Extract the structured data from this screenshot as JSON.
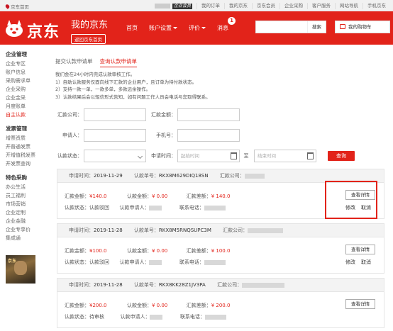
{
  "topbar": {
    "home": "京东首页",
    "user_tag": "企业会员",
    "links": [
      "我的订单",
      "我的京东",
      "京东会员",
      "企业采购",
      "客户服务",
      "网站导航",
      "手机京东"
    ]
  },
  "header": {
    "logo_text": "京东",
    "my_jd": "我的京东",
    "back_home": "返回京东首页",
    "nav": [
      {
        "label": "首页"
      },
      {
        "label": "账户设置",
        "dropdown": true
      },
      {
        "label": "评价",
        "dropdown": true
      },
      {
        "label": "消息",
        "badge": "1"
      }
    ],
    "search_button": "搜索",
    "cart": "我的购物车",
    "brand_color": "#e2231a"
  },
  "sidebar": {
    "sections": [
      {
        "title": "企业管理",
        "items": [
          "企业专区",
          "账户信息",
          "采购需求单",
          "企业采购",
          "企业金采",
          "月度账单",
          "自主认款"
        ]
      },
      {
        "title": "发票管理",
        "items": [
          "增票资质",
          "开普通发票",
          "开增值税发票",
          "开发票查询"
        ]
      },
      {
        "title": "特色采购",
        "items": [
          "办公生活",
          "员工福利",
          "市场营销",
          "企业定制",
          "企业金融",
          "企业专享价",
          "集成通"
        ]
      }
    ],
    "active_item": "自主认款",
    "ad_text": "京东"
  },
  "tabs": [
    "提交认款申请单",
    "查询认款申请单"
  ],
  "active_tab": "查询认款申请单",
  "notes": [
    "我们会在24小时内完成认款审核工作。",
    "1）自助认款服务仅面向线下汇款的企业用户，且订单为待付款状态。",
    "2）支持一款一单，一款多单，多款远余操作。",
    "3）认款结果后会以短信形式告知，如有问题工作人员会电话与您取得联系。"
  ],
  "form": {
    "remit_company_label": "汇款公司：",
    "remit_amount_label": "汇款金额：",
    "applicant_label": "申请人：",
    "phone_label": "手机号：",
    "status_label": "认款状态：",
    "apply_time_label": "申请时间：",
    "start_placeholder": "起始时间",
    "to_label": "至",
    "end_placeholder": "结束时间",
    "query_button": "查询"
  },
  "labels": {
    "apply_time": "申请时间：",
    "order_no": "认款单号：",
    "remit_company": "汇款公司：",
    "remit_amount": "汇款金额：",
    "claim_amount": "认款金额：",
    "diff_amount": "汇款差额：",
    "status": "认款状态：",
    "applicant": "认款申请人：",
    "phone": "联系电话：",
    "detail_button": "查看详情",
    "modify": "修改",
    "cancel": "取消"
  },
  "records": [
    {
      "apply_time": "2019-11-29",
      "order_no": "RKX8M629DIQ18SN",
      "remit_amount": "¥140.0",
      "claim_amount": "¥ 0.00",
      "diff_amount": "¥ 140.0",
      "status": "认款驳回",
      "actions": [
        "修改",
        "取消"
      ]
    },
    {
      "apply_time": "2019-11-28",
      "order_no": "RKX8M5RNQSUPC3M",
      "remit_amount": "¥100.0",
      "claim_amount": "¥ 0.00",
      "diff_amount": "¥ 100.0",
      "status": "认款驳回",
      "actions": [
        "修改",
        "取消"
      ]
    },
    {
      "apply_time": "2019-11-28",
      "order_no": "RKX8KK28Z1JV3PA",
      "remit_amount": "¥200.0",
      "claim_amount": "¥ 0.00",
      "diff_amount": "¥ 200.0",
      "status": "待审核",
      "actions": []
    }
  ]
}
